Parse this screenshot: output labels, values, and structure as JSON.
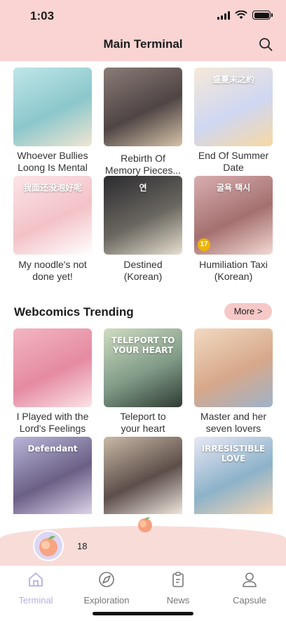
{
  "status": {
    "time": "1:03"
  },
  "header": {
    "title": "Main Terminal"
  },
  "featured": [
    {
      "caption": "Whoever Bullies\nLoong Is Mental",
      "cover_hint": "anime couple, teal hair",
      "colors": [
        "#bfe6e9",
        "#8bc7cc",
        "#f0e6d2"
      ]
    },
    {
      "caption": "Rebirth Of\nMemory Pieces...",
      "cover_hint": "dark embrace",
      "colors": [
        "#8a7b76",
        "#4f4545",
        "#d6c3a8"
      ]
    },
    {
      "caption": "End Of Summer\nDate",
      "cover_hint": "pastel text cover",
      "colors": [
        "#f6e9d8",
        "#cfd7f2",
        "#f7d8a3"
      ],
      "cover_text": "盛夏末之約"
    },
    {
      "caption": "My noodle's not\ndone yet!",
      "cover_hint": "pink sketch",
      "colors": [
        "#fbe4e6",
        "#f3c2c7",
        "#ffffff"
      ],
      "cover_text": "我面还没泡好呢"
    },
    {
      "caption": "Destined\n(Korean)",
      "cover_hint": "dark suits",
      "colors": [
        "#2b2a2f",
        "#6a6760",
        "#e7dfcf"
      ],
      "cover_text": "연"
    },
    {
      "caption": "Humiliation Taxi\n(Korean)",
      "cover_hint": "red couple",
      "colors": [
        "#d9aeb1",
        "#a4706f",
        "#f3d9d4"
      ],
      "cover_text": "굴욕 택시",
      "badge": "17"
    }
  ],
  "trending": {
    "section_title": "Webcomics Trending",
    "more_label": "More >",
    "items": [
      {
        "caption": "I Played with the\nLord's Feelings",
        "cover_hint": "pink hair",
        "colors": [
          "#f2b6c2",
          "#e58aa1",
          "#fae3e6"
        ]
      },
      {
        "caption": "Teleport to\nyour heart",
        "cover_hint": "green piano",
        "colors": [
          "#cfdcc2",
          "#7f9a86",
          "#2f3b33"
        ],
        "cover_text": "TELEPORT TO YOUR HEART"
      },
      {
        "caption": "Master and her\nseven lovers",
        "cover_hint": "golden couple",
        "colors": [
          "#f1d9c1",
          "#d7a88a",
          "#9fb3c9"
        ]
      },
      {
        "caption": "",
        "cover_hint": "purple ball",
        "colors": [
          "#b9b6d9",
          "#6b5f86",
          "#dcd3ea"
        ],
        "cover_text": "Defendant"
      },
      {
        "caption": "",
        "cover_hint": "suited pair",
        "colors": [
          "#c9b9a6",
          "#5d4e4a",
          "#eee6dd"
        ]
      },
      {
        "caption": "",
        "cover_hint": "blue hair lovers",
        "colors": [
          "#e9e8f5",
          "#8cb2c9",
          "#f5d6b5"
        ],
        "cover_text": "IRRESISTIBLE LOVE"
      }
    ]
  },
  "user_bar": {
    "peach_count": "18"
  },
  "tabs": [
    {
      "label": "Terminal",
      "icon": "home-icon",
      "active": true
    },
    {
      "label": "Exploration",
      "icon": "compass-icon",
      "active": false
    },
    {
      "label": "News",
      "icon": "clipboard-icon",
      "active": false
    },
    {
      "label": "Capsule",
      "icon": "person-icon",
      "active": false
    }
  ]
}
